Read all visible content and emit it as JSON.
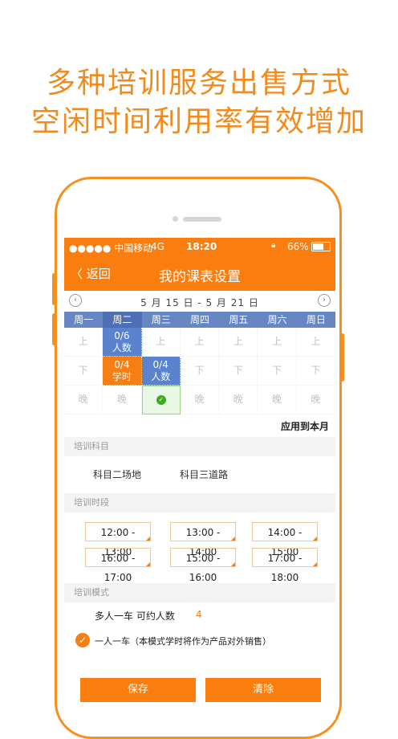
{
  "headline": {
    "line1": "多种培训服务出售方式",
    "line2": "空闲时间利用率有效增加"
  },
  "statusbar": {
    "carrier": "●●●●● 中国移动",
    "network": "4G",
    "time": "18:20",
    "battery": "66%"
  },
  "navbar": {
    "back": "〈 返回",
    "title": "我的课表设置"
  },
  "week": {
    "prev_icon": "chevron-left-icon",
    "next_icon": "chevron-right-icon",
    "range": "5 月 15 日 - 5 月 21 日",
    "days": [
      "周一",
      "周二",
      "周三",
      "周四",
      "周五",
      "周六",
      "周日"
    ]
  },
  "schedule": {
    "rows": [
      [
        {
          "t": "上"
        },
        {
          "t": "0/6\n人数",
          "s": "blue"
        },
        {
          "t": "上"
        },
        {
          "t": "上"
        },
        {
          "t": "上"
        },
        {
          "t": "上"
        },
        {
          "t": "上"
        }
      ],
      [
        {
          "t": "下"
        },
        {
          "t": "0/4\n学时",
          "s": "orange"
        },
        {
          "t": "0/4\n人数",
          "s": "blue"
        },
        {
          "t": "下"
        },
        {
          "t": "下"
        },
        {
          "t": "下"
        },
        {
          "t": "下"
        }
      ],
      [
        {
          "t": "晚"
        },
        {
          "t": "晚"
        },
        {
          "t": "✓",
          "s": "green"
        },
        {
          "t": "晚"
        },
        {
          "t": "晚"
        },
        {
          "t": "晚"
        },
        {
          "t": "晚"
        }
      ]
    ]
  },
  "apply_label": "应用到本月",
  "sections": {
    "subject": "培训科目",
    "time": "培训时段",
    "mode": "培训模式"
  },
  "subjects": [
    "科目二场地",
    "科目三道路"
  ],
  "time_slots": [
    "12:00 - 13:00",
    "13:00 - 14:00",
    "14:00 - 15:00",
    "16:00 - 17:00",
    "15:00 - 16:00",
    "17:00 - 18:00"
  ],
  "mode": {
    "multi": "多人一车   可约人数",
    "multi_count": "4",
    "single": "一人一车（本模式学时将作为产品对外销售）",
    "check": "✓"
  },
  "buttons": {
    "save": "保存",
    "clear": "清除"
  },
  "colors": {
    "accent": "#f97e0f",
    "blue": "#5a82cd",
    "green": "#3daa1f"
  }
}
